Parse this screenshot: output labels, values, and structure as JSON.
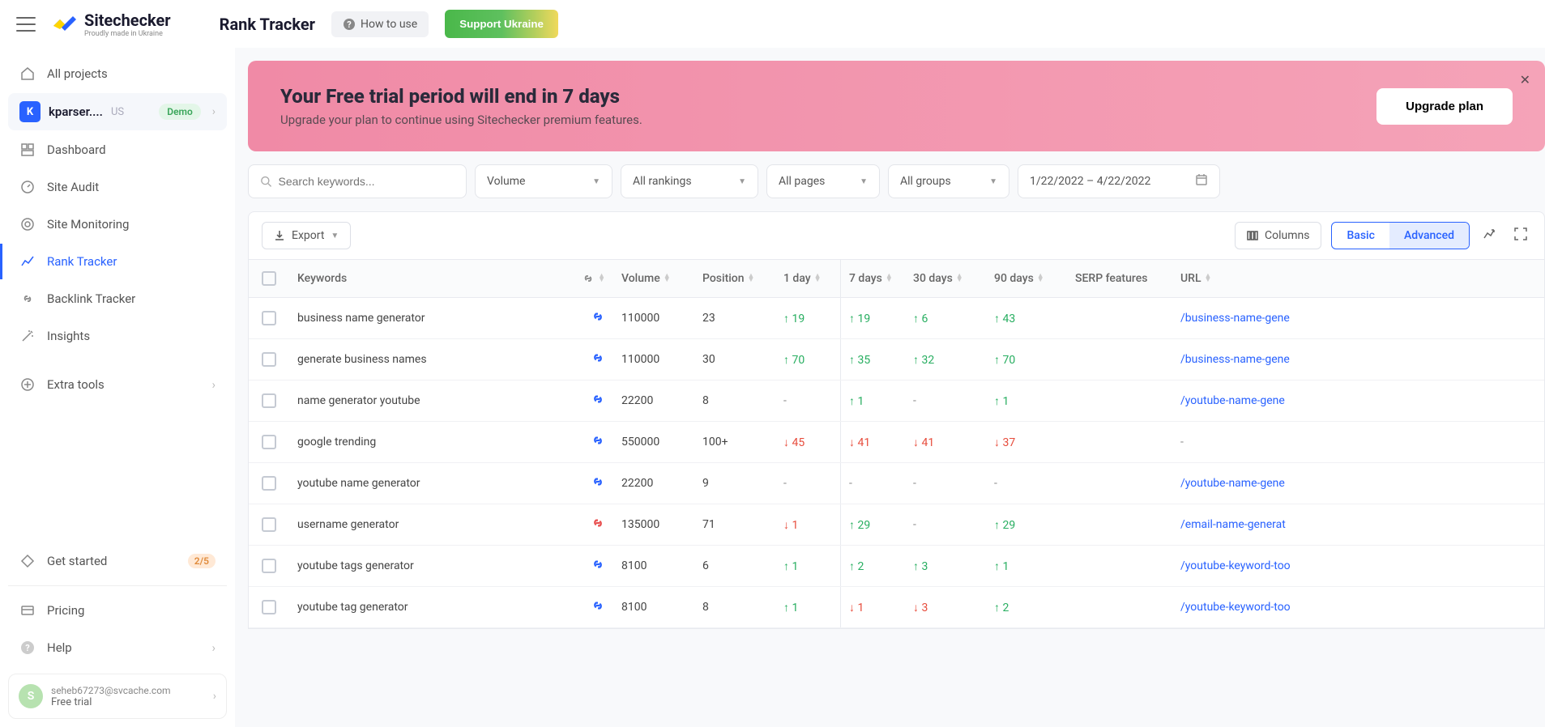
{
  "header": {
    "logo_title": "Sitechecker",
    "logo_sub": "Proudly made in Ukraine",
    "page_title": "Rank Tracker",
    "how_to_use": "How to use",
    "support": "Support Ukraine"
  },
  "sidebar": {
    "all_projects": "All projects",
    "project": {
      "badge": "K",
      "name": "kparser....",
      "country": "US",
      "demo": "Demo"
    },
    "items": {
      "dashboard": "Dashboard",
      "site_audit": "Site Audit",
      "site_monitoring": "Site Monitoring",
      "rank_tracker": "Rank Tracker",
      "backlink_tracker": "Backlink Tracker",
      "insights": "Insights",
      "extra_tools": "Extra tools",
      "get_started": "Get started",
      "get_started_badge": "2/5",
      "pricing": "Pricing",
      "help": "Help"
    },
    "user": {
      "initial": "S",
      "email": "seheb67273@svcache.com",
      "plan": "Free trial"
    }
  },
  "banner": {
    "title": "Your Free trial period will end in 7 days",
    "subtitle": "Upgrade your plan to continue using Sitechecker premium features.",
    "cta": "Upgrade plan"
  },
  "filters": {
    "search_placeholder": "Search keywords...",
    "volume": "Volume",
    "rankings": "All rankings",
    "pages": "All pages",
    "groups": "All groups",
    "date": "1/22/2022 – 4/22/2022"
  },
  "toolbar": {
    "export": "Export",
    "columns": "Columns",
    "basic": "Basic",
    "advanced": "Advanced"
  },
  "columns": {
    "keywords": "Keywords",
    "volume": "Volume",
    "position": "Position",
    "d1": "1 day",
    "d7": "7 days",
    "d30": "30 days",
    "d90": "90 days",
    "serp": "SERP features",
    "url": "URL"
  },
  "rows": [
    {
      "kw": "business name generator",
      "vol": "110000",
      "pos": "23",
      "d1": {
        "v": "19",
        "d": "up"
      },
      "d7": {
        "v": "19",
        "d": "up"
      },
      "d30": {
        "v": "6",
        "d": "up"
      },
      "d90": {
        "v": "43",
        "d": "up"
      },
      "url": "/business-name-gene",
      "linkred": false
    },
    {
      "kw": "generate business names",
      "vol": "110000",
      "pos": "30",
      "d1": {
        "v": "70",
        "d": "up"
      },
      "d7": {
        "v": "35",
        "d": "up"
      },
      "d30": {
        "v": "32",
        "d": "up"
      },
      "d90": {
        "v": "70",
        "d": "up"
      },
      "url": "/business-name-gene",
      "linkred": false
    },
    {
      "kw": "name generator youtube",
      "vol": "22200",
      "pos": "8",
      "d1": {
        "v": "-",
        "d": "dash"
      },
      "d7": {
        "v": "1",
        "d": "up"
      },
      "d30": {
        "v": "-",
        "d": "dash"
      },
      "d90": {
        "v": "1",
        "d": "up"
      },
      "url": "/youtube-name-gene",
      "linkred": false
    },
    {
      "kw": "google trending",
      "vol": "550000",
      "pos": "100+",
      "d1": {
        "v": "45",
        "d": "down"
      },
      "d7": {
        "v": "41",
        "d": "down"
      },
      "d30": {
        "v": "41",
        "d": "down"
      },
      "d90": {
        "v": "37",
        "d": "down"
      },
      "url": "-",
      "linkred": false
    },
    {
      "kw": "youtube name generator",
      "vol": "22200",
      "pos": "9",
      "d1": {
        "v": "-",
        "d": "dash"
      },
      "d7": {
        "v": "-",
        "d": "dash"
      },
      "d30": {
        "v": "-",
        "d": "dash"
      },
      "d90": {
        "v": "-",
        "d": "dash"
      },
      "url": "/youtube-name-gene",
      "linkred": false
    },
    {
      "kw": "username generator",
      "vol": "135000",
      "pos": "71",
      "d1": {
        "v": "1",
        "d": "down"
      },
      "d7": {
        "v": "29",
        "d": "up"
      },
      "d30": {
        "v": "-",
        "d": "dash"
      },
      "d90": {
        "v": "29",
        "d": "up"
      },
      "url": "/email-name-generat",
      "linkred": true
    },
    {
      "kw": "youtube tags generator",
      "vol": "8100",
      "pos": "6",
      "d1": {
        "v": "1",
        "d": "up"
      },
      "d7": {
        "v": "2",
        "d": "up"
      },
      "d30": {
        "v": "3",
        "d": "up"
      },
      "d90": {
        "v": "1",
        "d": "up"
      },
      "url": "/youtube-keyword-too",
      "linkred": false
    },
    {
      "kw": "youtube tag generator",
      "vol": "8100",
      "pos": "8",
      "d1": {
        "v": "1",
        "d": "up"
      },
      "d7": {
        "v": "1",
        "d": "down"
      },
      "d30": {
        "v": "3",
        "d": "down"
      },
      "d90": {
        "v": "2",
        "d": "up"
      },
      "url": "/youtube-keyword-too",
      "linkred": false
    }
  ]
}
